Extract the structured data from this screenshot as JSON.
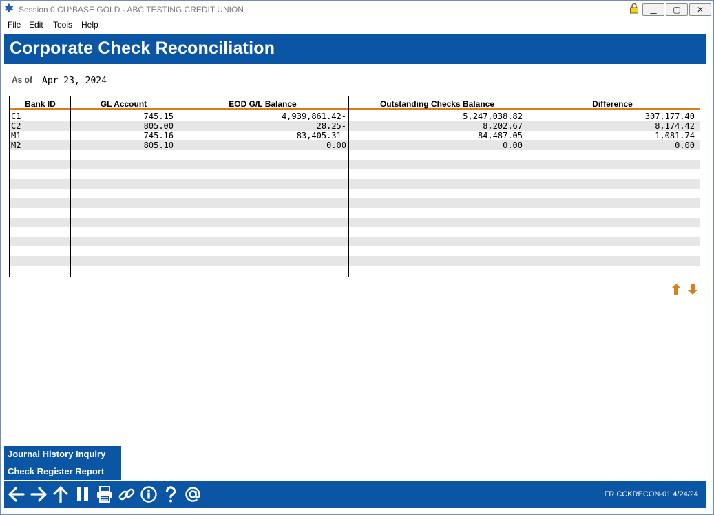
{
  "window": {
    "title": "Session 0 CU*BASE GOLD - ABC TESTING CREDIT UNION",
    "controls": [
      "minimize",
      "maximize",
      "close"
    ]
  },
  "menu": [
    "File",
    "Edit",
    "Tools",
    "Help"
  ],
  "page": {
    "title": "Corporate Check Reconciliation",
    "as_of_label": "As of",
    "as_of_value": "Apr 23, 2024"
  },
  "table": {
    "columns": [
      "Bank ID",
      "GL Account",
      "EOD G/L Balance",
      "Outstanding Checks Balance",
      "Difference"
    ],
    "rows": [
      [
        "C1",
        "745.15",
        "4,939,861.42-",
        "5,247,038.82",
        "307,177.40"
      ],
      [
        "C2",
        "805.00",
        "28.25-",
        "8,202.67",
        "8,174.42"
      ],
      [
        "M1",
        "745.16",
        "83,405.31-",
        "84,487.05",
        "1,081.74"
      ],
      [
        "M2",
        "805.10",
        "0.00",
        "0.00",
        "0.00"
      ]
    ]
  },
  "actions": [
    "Journal History Inquiry",
    "Check Register Report"
  ],
  "footer": {
    "icons": [
      "back-arrow-icon",
      "forward-arrow-icon",
      "up-arrow-icon",
      "pause-icon",
      "print-icon",
      "link-icon",
      "info-icon",
      "help-icon",
      "at-icon"
    ],
    "screen_code": "FR CCKRECON-01 4/24/24"
  },
  "colors": {
    "brand_blue": "#0a56a5",
    "accent_orange": "#e07a18",
    "row_alt": "#e6e6e6"
  }
}
